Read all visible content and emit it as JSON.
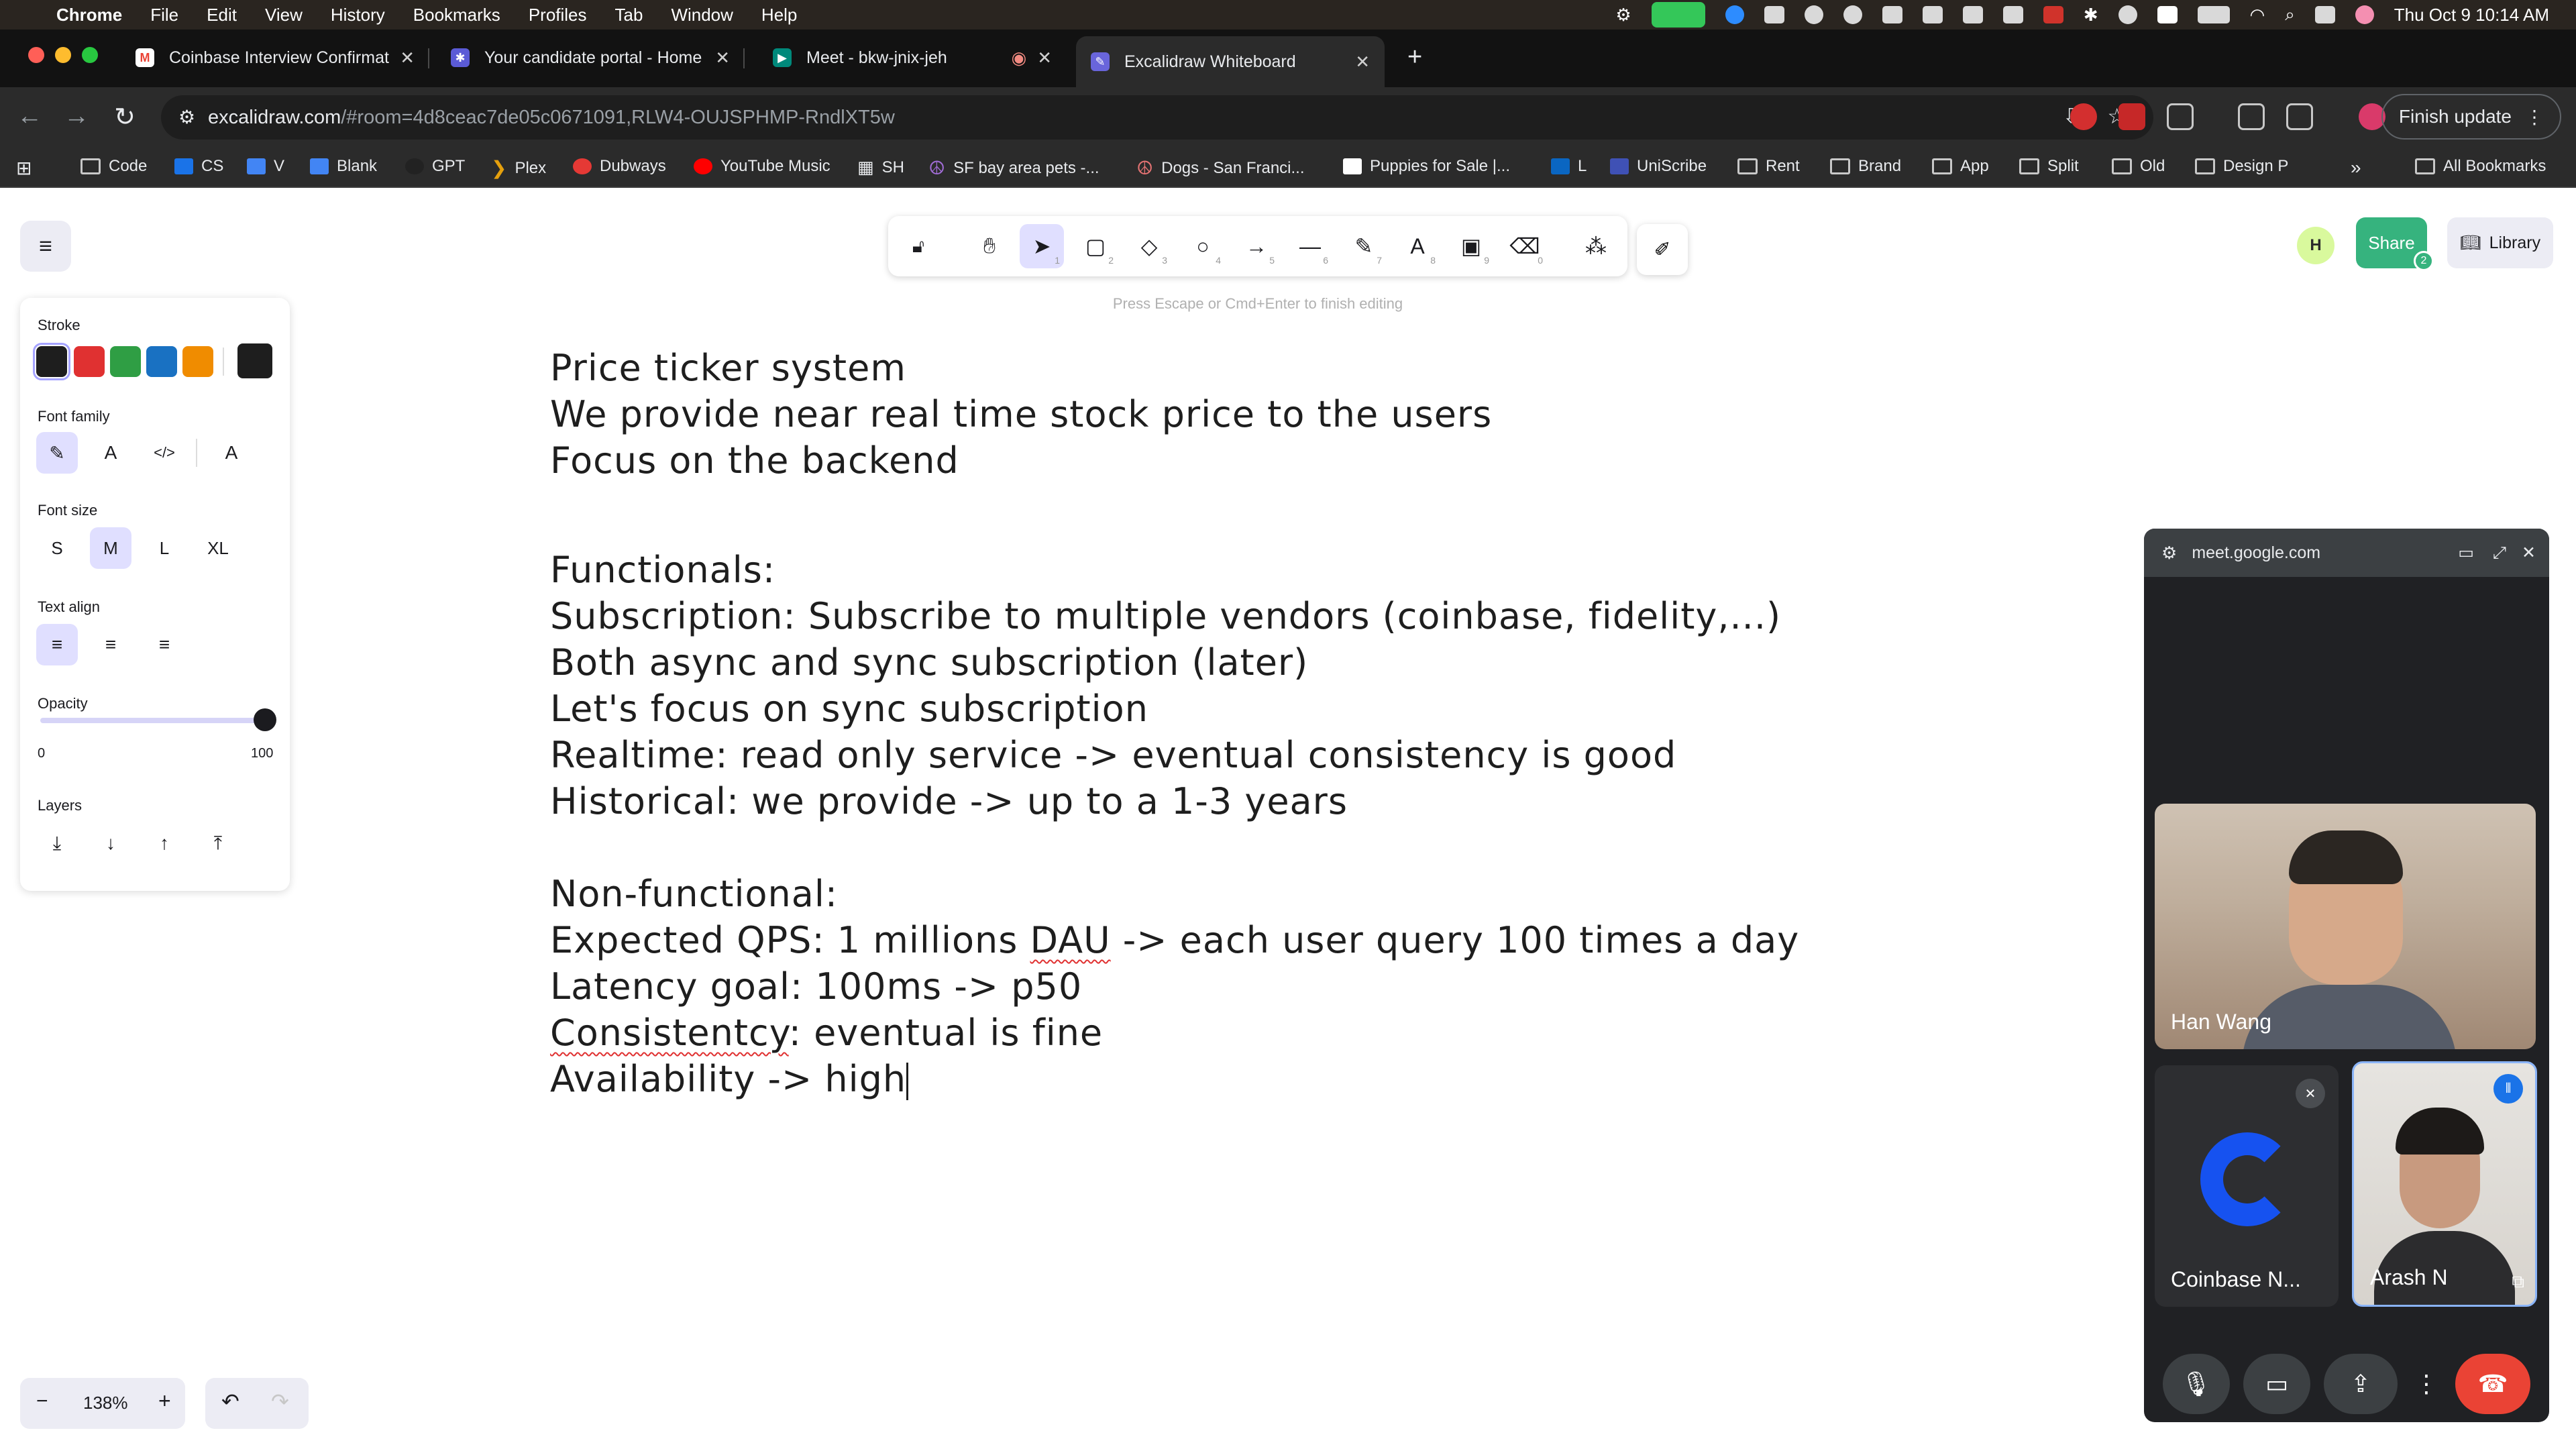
{
  "menubar": {
    "app": "Chrome",
    "items": [
      "File",
      "Edit",
      "View",
      "History",
      "Bookmarks",
      "Profiles",
      "Tab",
      "Window",
      "Help"
    ],
    "datetime": "Thu Oct 9  10:14 AM"
  },
  "tabs": [
    {
      "title": "Coinbase Interview Confirmat",
      "icon": "gmail-icon",
      "color": "#ea4335"
    },
    {
      "title": "Your candidate portal - Home",
      "icon": "portal-icon",
      "color": "#5b5bd6"
    },
    {
      "title": "Meet - bkw-jnix-jeh",
      "icon": "meet-icon",
      "color": "#00897b"
    },
    {
      "title": "Excalidraw Whiteboard",
      "icon": "excalidraw-icon",
      "color": "#6965db"
    }
  ],
  "address": {
    "host": "excalidraw.com",
    "path": "/#room=4d8ceac7de05c0671091,RLW4-OUJSPHMP-RndlXT5w",
    "finish_update": "Finish update"
  },
  "bookmarks": [
    {
      "label": "",
      "icon": "apps-grid-icon"
    },
    {
      "label": "Code",
      "icon": "folder-icon"
    },
    {
      "label": "CS",
      "icon": "cs-icon"
    },
    {
      "label": "V",
      "icon": "doc-icon"
    },
    {
      "label": "Blank",
      "icon": "doc-icon"
    },
    {
      "label": "GPT",
      "icon": "gpt-icon"
    },
    {
      "label": "Plex",
      "icon": "plex-icon"
    },
    {
      "label": "Dubways",
      "icon": "dubways-icon"
    },
    {
      "label": "YouTube Music",
      "icon": "youtube-music-icon"
    },
    {
      "label": "SH",
      "icon": "sh-icon"
    },
    {
      "label": "SF bay area pets -...",
      "icon": "peace-icon"
    },
    {
      "label": "Dogs - San Franci...",
      "icon": "peace-icon"
    },
    {
      "label": "Puppies for Sale |...",
      "icon": "puppy-icon"
    },
    {
      "label": "L",
      "icon": "linkedin-icon"
    },
    {
      "label": "UniScribe",
      "icon": "uniscribe-icon"
    },
    {
      "label": "Rent",
      "icon": "folder-icon"
    },
    {
      "label": "Brand",
      "icon": "folder-icon"
    },
    {
      "label": "App",
      "icon": "folder-icon"
    },
    {
      "label": "Split",
      "icon": "folder-icon"
    },
    {
      "label": "Old",
      "icon": "folder-icon"
    },
    {
      "label": "Design P",
      "icon": "folder-icon"
    }
  ],
  "all_bookmarks": "All Bookmarks",
  "excalidraw": {
    "hint": "Press Escape or Cmd+Enter to finish editing",
    "share": "Share",
    "share_count": "2",
    "library": "Library",
    "collaborator_initial": "H",
    "tool_numbers": [
      "1",
      "2",
      "3",
      "4",
      "5",
      "6",
      "7",
      "8",
      "9",
      "0"
    ],
    "zoom": "138%"
  },
  "props": {
    "stroke": "Stroke",
    "stroke_colors": [
      "#1e1e1e",
      "#e03131",
      "#2f9e44",
      "#1971c2",
      "#f08c00"
    ],
    "current_color": "#1e1e1e",
    "font_family": "Font family",
    "font_size": "Font size",
    "sizes": [
      "S",
      "M",
      "L",
      "XL"
    ],
    "text_align": "Text align",
    "opacity": "Opacity",
    "opacity_min": "0",
    "opacity_max": "100",
    "layers": "Layers"
  },
  "board": {
    "lines1": [
      "Price ticker system",
      "We provide near real time stock price to the users",
      "Focus on the backend"
    ],
    "lines2": [
      "Functionals:",
      "Subscription: Subscribe to multiple vendors (coinbase, fidelity,...)",
      "Both async and sync subscription (later)",
      "Let's focus on sync subscription",
      "Realtime: read only service -> eventual consistency is good",
      "Historical: we provide -> up to a 1-3 years"
    ],
    "nf_title": "Non-functional:",
    "qps_pre": "Expected QPS: 1 millions ",
    "qps_dau": "DAU",
    "qps_post": " -> each user query 100 times a day",
    "latency": "Latency goal: 100ms -> p50",
    "cons_word": "Consistentcy",
    "cons_rest": ": eventual is fine",
    "availability": "Availability -> high"
  },
  "meet": {
    "host": "meet.google.com",
    "participants": [
      "Han Wang",
      "Coinbase N...",
      "Arash N"
    ]
  }
}
